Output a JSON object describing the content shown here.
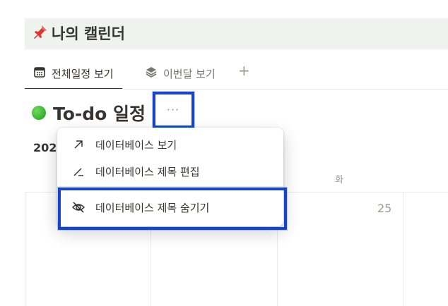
{
  "page": {
    "title_icon": "pushpin-icon",
    "title": "나의 캘린더"
  },
  "tabs": [
    {
      "label": "전체일정 보기",
      "icon": "calendar-icon",
      "active": true
    },
    {
      "label": "이번달 보기",
      "icon": "layers-icon",
      "active": false
    }
  ],
  "tab_add_label": "+",
  "database": {
    "title": "To-do 일정",
    "more_label": "···",
    "year_label": "202"
  },
  "calendar": {
    "weekday_label": "화",
    "day_number": "25"
  },
  "menu": {
    "items": [
      {
        "label": "데이터베이스 보기",
        "icon": "arrow-up-right-icon"
      },
      {
        "label": "데이터베이스 제목 편집",
        "icon": "edit-pen-icon"
      },
      {
        "label": "데이터베이스 제목 숨기기",
        "icon": "eye-off-icon"
      }
    ]
  },
  "colors": {
    "highlight": "#1446c8",
    "title_bar_bg": "#eef3ed",
    "status_dot": "#2eb82e"
  }
}
